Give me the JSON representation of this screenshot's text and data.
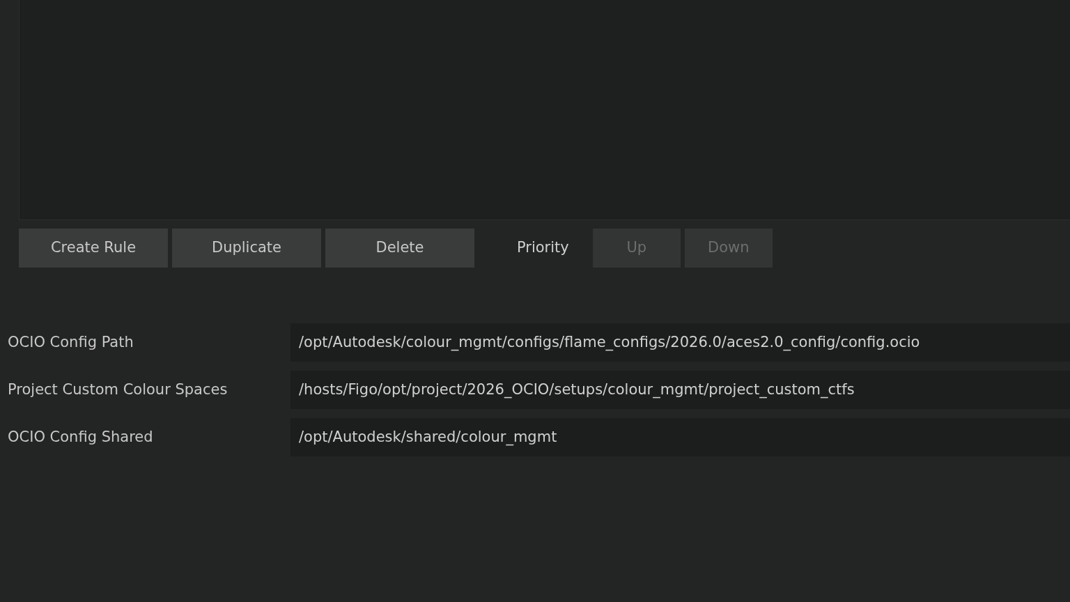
{
  "toolbar": [
    {
      "kind": "button",
      "label": "Create Rule",
      "disabled": false
    },
    {
      "kind": "button",
      "label": "Duplicate",
      "disabled": false
    },
    {
      "kind": "button",
      "label": "Delete",
      "disabled": false
    },
    {
      "kind": "label",
      "label": "Priority"
    },
    {
      "kind": "button",
      "label": "Up",
      "disabled": true
    },
    {
      "kind": "button",
      "label": "Down",
      "disabled": true
    }
  ],
  "settings": [
    {
      "label": "OCIO Config Path",
      "value": "/opt/Autodesk/colour_mgmt/configs/flame_configs/2026.0/aces2.0_config/config.ocio"
    },
    {
      "label": "Project Custom Colour Spaces",
      "value": "/hosts/Figo/opt/project/2026_OCIO/setups/colour_mgmt/project_custom_ctfs"
    },
    {
      "label": "OCIO Config Shared",
      "value": "/opt/Autodesk/shared/colour_mgmt"
    }
  ]
}
